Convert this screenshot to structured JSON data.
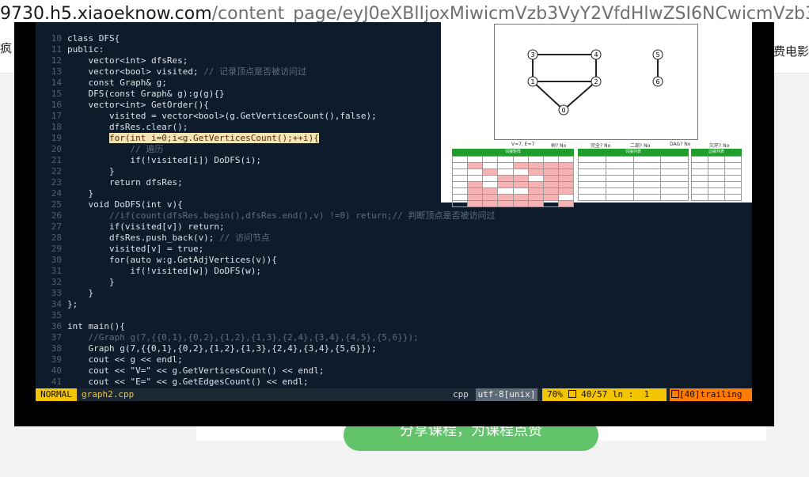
{
  "browser": {
    "url_host": "9730.h5.xiaoeknow.com",
    "url_path": "/content_page/eyJ0eXBlIjoxMiwicmVzb3VyY2VfdHlwZSI6NCwicmVzb3VyY2Vfa",
    "bg_left_text": "疯",
    "bg_right_text": "费电影",
    "green_button_label": "分享课程，为课程点赞"
  },
  "editor": {
    "lines": [
      {
        "n": "10",
        "text": "class DFS{",
        "kind": "code"
      },
      {
        "n": "11",
        "text": "public:",
        "kind": "code"
      },
      {
        "n": "12",
        "text": "    vector<int> dfsRes;",
        "kind": "code"
      },
      {
        "n": "13",
        "text": "    vector<bool> visited; ",
        "comment": "// 记录顶点是否被访问过",
        "kind": "mixed"
      },
      {
        "n": "14",
        "text": "    const Graph& g;",
        "kind": "code"
      },
      {
        "n": "15",
        "text": "    DFS(const Graph& g):g(g){}",
        "kind": "code"
      },
      {
        "n": "16",
        "text": "    vector<int> GetOrder(){",
        "kind": "code"
      },
      {
        "n": "17",
        "text": "        visited = vector<bool>(g.GetVerticesCount(),false);",
        "kind": "code"
      },
      {
        "n": "18",
        "text": "        dfsRes.clear();",
        "kind": "code"
      },
      {
        "n": "19",
        "text": "        ",
        "hl": "for(int i=0;i<g.GetVerticesCount();++i){",
        "kind": "hl"
      },
      {
        "n": "20",
        "text": "            ",
        "comment": "// 遍历",
        "kind": "mixed"
      },
      {
        "n": "21",
        "text": "            if(!visited[i]) DoDFS(i);",
        "kind": "code"
      },
      {
        "n": "22",
        "text": "        }",
        "kind": "code"
      },
      {
        "n": "23",
        "text": "        return dfsRes;",
        "kind": "code"
      },
      {
        "n": "24",
        "text": "    }",
        "kind": "code"
      },
      {
        "n": "25",
        "text": "    void DoDFS(int v){",
        "kind": "code"
      },
      {
        "n": "26",
        "text": "        ",
        "comment": "//if(count(dfsRes.begin(),dfsRes.end(),v) !=0) return;// 判断顶点是否被访问过",
        "kind": "mixed"
      },
      {
        "n": "27",
        "text": "        if(visited[v]) return;",
        "kind": "code"
      },
      {
        "n": "28",
        "text": "        dfsRes.push_back(v); ",
        "comment": "// 访问节点",
        "kind": "mixed"
      },
      {
        "n": "29",
        "text": "        visited[v] = true;",
        "kind": "code"
      },
      {
        "n": "30",
        "text": "        for(auto w:g.GetAdjVertices(v)){",
        "kind": "code"
      },
      {
        "n": "31",
        "text": "            if(!visited[w]) DoDFS(w);",
        "kind": "code"
      },
      {
        "n": "32",
        "text": "        }",
        "kind": "code"
      },
      {
        "n": "33",
        "text": "    }",
        "kind": "code"
      },
      {
        "n": "34",
        "text": "};",
        "kind": "code"
      },
      {
        "n": "35",
        "text": "",
        "kind": "code"
      },
      {
        "n": "36",
        "text": "int main(){",
        "kind": "code"
      },
      {
        "n": "37",
        "text": "    ",
        "comment": "//Graph g(7,{{0,1},{0,2},{1,2},{1,3},{2,4},{3,4},{4,5},{5,6}});",
        "kind": "mixed"
      },
      {
        "n": "38",
        "text": "    Graph g(7,{{0,1},{0,2},{1,2},{1,3},{2,4},{3,4},{5,6}});",
        "kind": "code"
      },
      {
        "n": "39",
        "text": "    cout << g << endl;",
        "kind": "code"
      },
      {
        "n": "40",
        "text": "    cout << \"V=\" << g.GetVerticesCount() << endl;",
        "kind": "code"
      },
      {
        "n": "41",
        "text": "    cout << \"E=\" << g.GetEdgesCount() << endl;",
        "kind": "code"
      }
    ]
  },
  "statusbar": {
    "mode": "NORMAL",
    "filename": "graph2.cpp",
    "filetype": "cpp",
    "encoding": "utf-8[unix]",
    "percent": "70%",
    "position": "40/57 ln :  1",
    "trailing": "[40]trailing"
  },
  "graph": {
    "nodes": [
      "0",
      "1",
      "2",
      "3",
      "4",
      "5",
      "6"
    ],
    "info": [
      "V=7, E=7",
      "树? No",
      "完全? No",
      "二部? No",
      "DAG? No",
      "欠环? No"
    ],
    "table_titles": [
      "邻接矩阵",
      "邻接列表",
      "边缘列表"
    ]
  },
  "colors": {
    "editor_bg": "#0d1b2a",
    "mode_bg": "#f3c400",
    "trailing_bg": "#ff7a00",
    "table_header": "#1f9d2d"
  }
}
